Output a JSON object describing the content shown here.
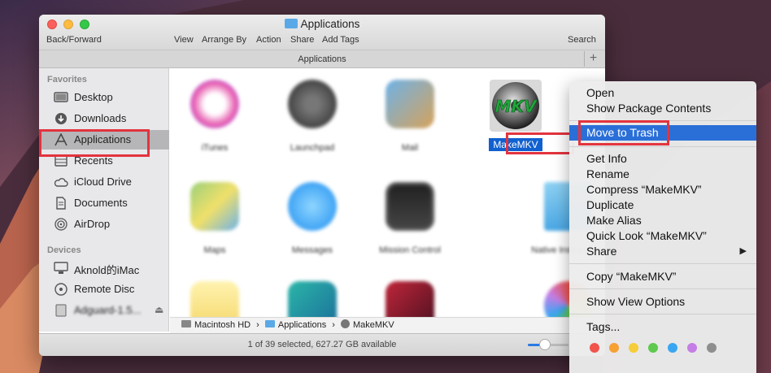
{
  "window": {
    "title": "Applications",
    "toolbar": {
      "back_forward": "Back/Forward",
      "view": "View",
      "arrange_by": "Arrange By",
      "action": "Action",
      "share": "Share",
      "add_tags": "Add Tags",
      "search": "Search"
    },
    "location_title": "Applications",
    "plus": "+"
  },
  "sidebar": {
    "favorites_header": "Favorites",
    "favorites": [
      {
        "label": "Desktop",
        "icon": "desktop-icon"
      },
      {
        "label": "Downloads",
        "icon": "downloads-icon"
      },
      {
        "label": "Applications",
        "icon": "applications-icon"
      },
      {
        "label": "Recents",
        "icon": "recents-icon"
      },
      {
        "label": "iCloud Drive",
        "icon": "cloud-icon"
      },
      {
        "label": "Documents",
        "icon": "documents-icon"
      },
      {
        "label": "AirDrop",
        "icon": "airdrop-icon"
      }
    ],
    "devices_header": "Devices",
    "devices": [
      {
        "label": "Aknold的iMac",
        "icon": "imac-icon"
      },
      {
        "label": "Remote Disc",
        "icon": "disc-icon"
      },
      {
        "label": "Adguard-1.5...",
        "icon": "disk-image-icon"
      }
    ]
  },
  "apps": [
    {
      "name": "iTunes"
    },
    {
      "name": "Launchpad"
    },
    {
      "name": "Mail"
    },
    {
      "name": "MakeMKV",
      "selected": true,
      "badge": "MKV"
    },
    {
      "name": "Maps"
    },
    {
      "name": "Messages"
    },
    {
      "name": "Mission Control"
    },
    {
      "name": "Native Instruments"
    }
  ],
  "path_bar": {
    "segments": [
      "Macintosh HD",
      "Applications",
      "MakeMKV"
    ],
    "separator": "›"
  },
  "status": "1 of 39 selected, 627.27 GB available",
  "context_menu": {
    "items": [
      "Open",
      "Show Package Contents",
      "Move to Trash",
      "Get Info",
      "Rename",
      "Compress “MakeMKV”",
      "Duplicate",
      "Make Alias",
      "Quick Look “MakeMKV”",
      "Share",
      "Copy “MakeMKV”",
      "Show View Options",
      "Tags..."
    ],
    "submenu_arrow": "▶",
    "tag_colors": [
      "#f0544d",
      "#f7a133",
      "#f6cd38",
      "#5ec94e",
      "#3aa6f2",
      "#c47ee6",
      "#8e8e8e"
    ]
  },
  "colors": {
    "highlight": "#e3343e",
    "menu_selection": "#2a6fd8"
  }
}
